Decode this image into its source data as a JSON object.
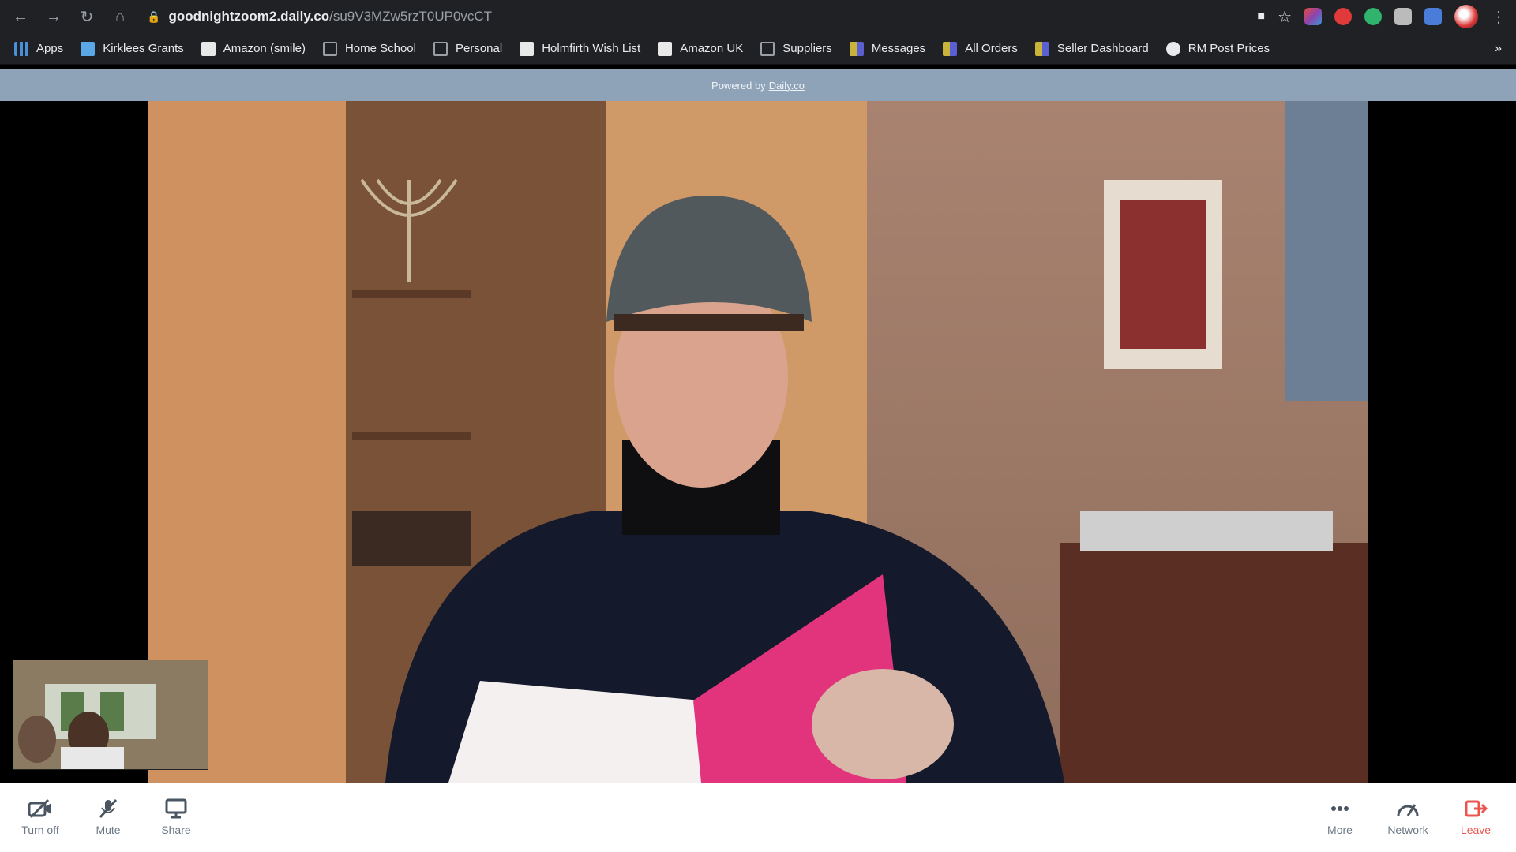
{
  "browser": {
    "url_host": "goodnightzoom2.daily.co",
    "url_path": "/su9V3MZw5rzT0UP0vcCT"
  },
  "bookmarks": [
    {
      "label": "Apps",
      "icon": "apps-grid-icon",
      "color": "#4a90d9"
    },
    {
      "label": "Kirklees Grants",
      "icon": "kirklees-icon",
      "color": "#5aa9e6"
    },
    {
      "label": "Amazon (smile)",
      "icon": "amazon-icon",
      "color": "#e8e8e8"
    },
    {
      "label": "Home School",
      "icon": "folder-icon",
      "color": "#9aa0a6"
    },
    {
      "label": "Personal",
      "icon": "folder-icon",
      "color": "#9aa0a6"
    },
    {
      "label": "Holmfirth Wish List",
      "icon": "amazon-icon",
      "color": "#e8e8e8"
    },
    {
      "label": "Amazon UK",
      "icon": "amazon-icon",
      "color": "#e8e8e8"
    },
    {
      "label": "Suppliers",
      "icon": "folder-icon",
      "color": "#9aa0a6"
    },
    {
      "label": "Messages",
      "icon": "messages-icon",
      "color": "#c9b33a"
    },
    {
      "label": "All Orders",
      "icon": "orders-icon",
      "color": "#c9b33a"
    },
    {
      "label": "Seller Dashboard",
      "icon": "seller-icon",
      "color": "#c9b33a"
    },
    {
      "label": "RM Post Prices",
      "icon": "globe-icon",
      "color": "#e8eaed"
    }
  ],
  "powered": {
    "prefix": "Powered by",
    "link": "Daily.co"
  },
  "tray": {
    "left": [
      {
        "label": "Turn off",
        "icon": "camera-off-icon"
      },
      {
        "label": "Mute",
        "icon": "mic-off-icon"
      },
      {
        "label": "Share",
        "icon": "screen-share-icon"
      }
    ],
    "right": [
      {
        "label": "More",
        "icon": "more-dots-icon"
      },
      {
        "label": "Network",
        "icon": "network-gauge-icon"
      },
      {
        "label": "Leave",
        "icon": "leave-icon"
      }
    ]
  },
  "colors": {
    "leave": "#e8564f",
    "powered_bar": "#8fa3b8"
  }
}
